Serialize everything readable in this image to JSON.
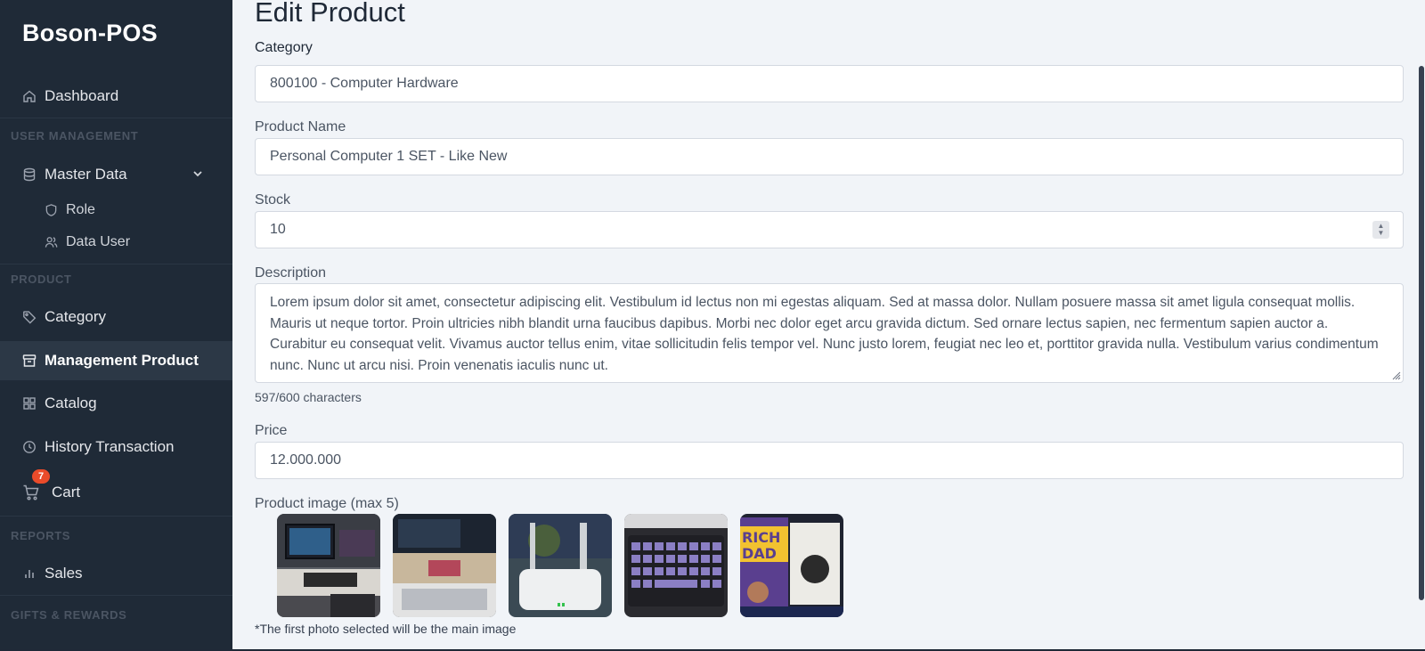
{
  "brand": "Boson-POS",
  "sidebar": {
    "dashboard": "Dashboard",
    "user_management_label": "USER MANAGEMENT",
    "master_data": "Master Data",
    "role": "Role",
    "data_user": "Data User",
    "product_label": "PRODUCT",
    "category": "Category",
    "management_product": "Management Product",
    "catalog": "Catalog",
    "history_transaction": "History Transaction",
    "cart": "Cart",
    "cart_badge": "7",
    "reports_label": "REPORTS",
    "sales": "Sales",
    "gifts_label": "GIFTS & REWARDS"
  },
  "form": {
    "title": "Edit Product",
    "category_label": "Category",
    "category_value": "800100 - Computer Hardware",
    "product_name_label": "Product Name",
    "product_name_value": "Personal Computer 1 SET - Like New",
    "stock_label": "Stock",
    "stock_value": "10",
    "description_label": "Description",
    "description_value": "Lorem ipsum dolor sit amet, consectetur adipiscing elit. Vestibulum id lectus non mi egestas aliquam. Sed at massa dolor. Nullam posuere massa sit amet ligula consequat mollis. Mauris ut neque tortor. Proin ultricies nibh blandit urna faucibus dapibus. Morbi nec dolor eget arcu gravida dictum. Sed ornare lectus sapien, nec fermentum sapien auctor a. Curabitur eu consequat velit. Vivamus auctor tellus enim, vitae sollicitudin felis tempor vel. Nunc justo lorem, feugiat nec leo et, porttitor gravida nulla. Vestibulum varius condimentum nunc. Nunc ut arcu nisi. Proin venenatis iaculis nunc ut.",
    "char_count": "597/600 characters",
    "price_label": "Price",
    "price_value": "12.000.000",
    "image_label": "Product image (max 5)",
    "image_note": "*The first photo selected will be the main image"
  },
  "icons": {
    "dashboard": "home-icon",
    "master_data": "database-icon",
    "role": "shield-icon",
    "data_user": "users-icon",
    "category": "tag-icon",
    "management_product": "archive-icon",
    "catalog": "grid-icon",
    "history_transaction": "clock-icon",
    "cart": "cart-icon",
    "sales": "bar-chart-icon"
  },
  "colors": {
    "sidebar_bg": "#1f2a37",
    "active_bg": "#2c3846",
    "badge": "#ea4b2a",
    "page_bg": "#f1f4f8"
  }
}
